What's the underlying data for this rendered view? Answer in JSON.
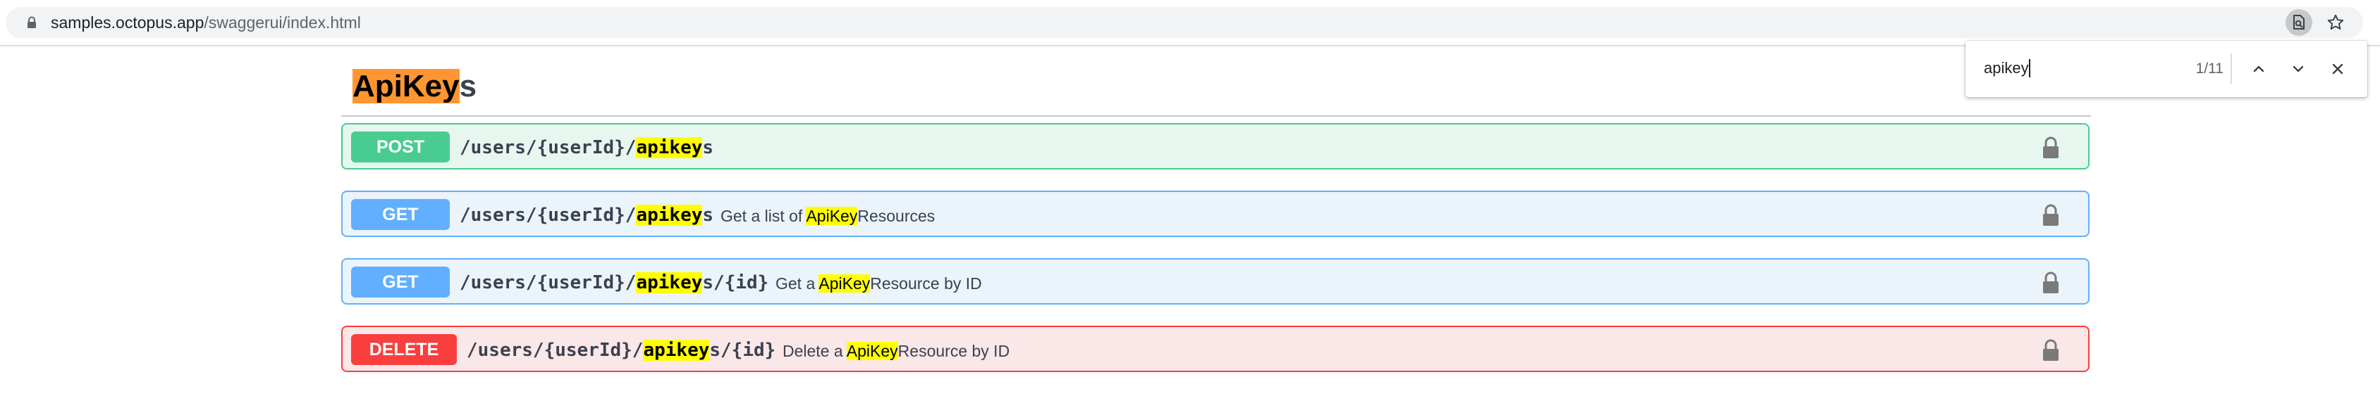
{
  "browser": {
    "url_host": "samples.octopus.app",
    "url_path": "/swaggerui/index.html",
    "icons": [
      "lock-icon",
      "search-in-page-icon",
      "star-icon"
    ]
  },
  "find_bar": {
    "query": "apikey",
    "match_count": "1/11",
    "icons": [
      "chevron-up-icon",
      "chevron-down-icon",
      "close-icon"
    ]
  },
  "section": {
    "title_highlight": "ApiKey",
    "title_rest": "s"
  },
  "operations": [
    {
      "method": "POST",
      "path_prefix": "/users/{userId}/",
      "path_highlight": "apikey",
      "path_suffix": "s",
      "summary_prefix": "",
      "summary_highlight": "",
      "summary_suffix": ""
    },
    {
      "method": "GET",
      "path_prefix": "/users/{userId}/",
      "path_highlight": "apikey",
      "path_suffix": "s",
      "summary_prefix": "Get a list of ",
      "summary_highlight": "ApiKey",
      "summary_suffix": "Resources"
    },
    {
      "method": "GET",
      "path_prefix": "/users/{userId}/",
      "path_highlight": "apikey",
      "path_suffix": "s/{id}",
      "summary_prefix": "Get a ",
      "summary_highlight": "ApiKey",
      "summary_suffix": "Resource by ID"
    },
    {
      "method": "DELETE",
      "path_prefix": "/users/{userId}/",
      "path_highlight": "apikey",
      "path_suffix": "s/{id}",
      "summary_prefix": "Delete a ",
      "summary_highlight": "ApiKey",
      "summary_suffix": "Resource by ID"
    }
  ],
  "colors": {
    "post": "#49cc90",
    "get": "#61affe",
    "delete": "#f93e3e",
    "find_current_match": "#ff9632",
    "find_match": "#ffff00"
  }
}
